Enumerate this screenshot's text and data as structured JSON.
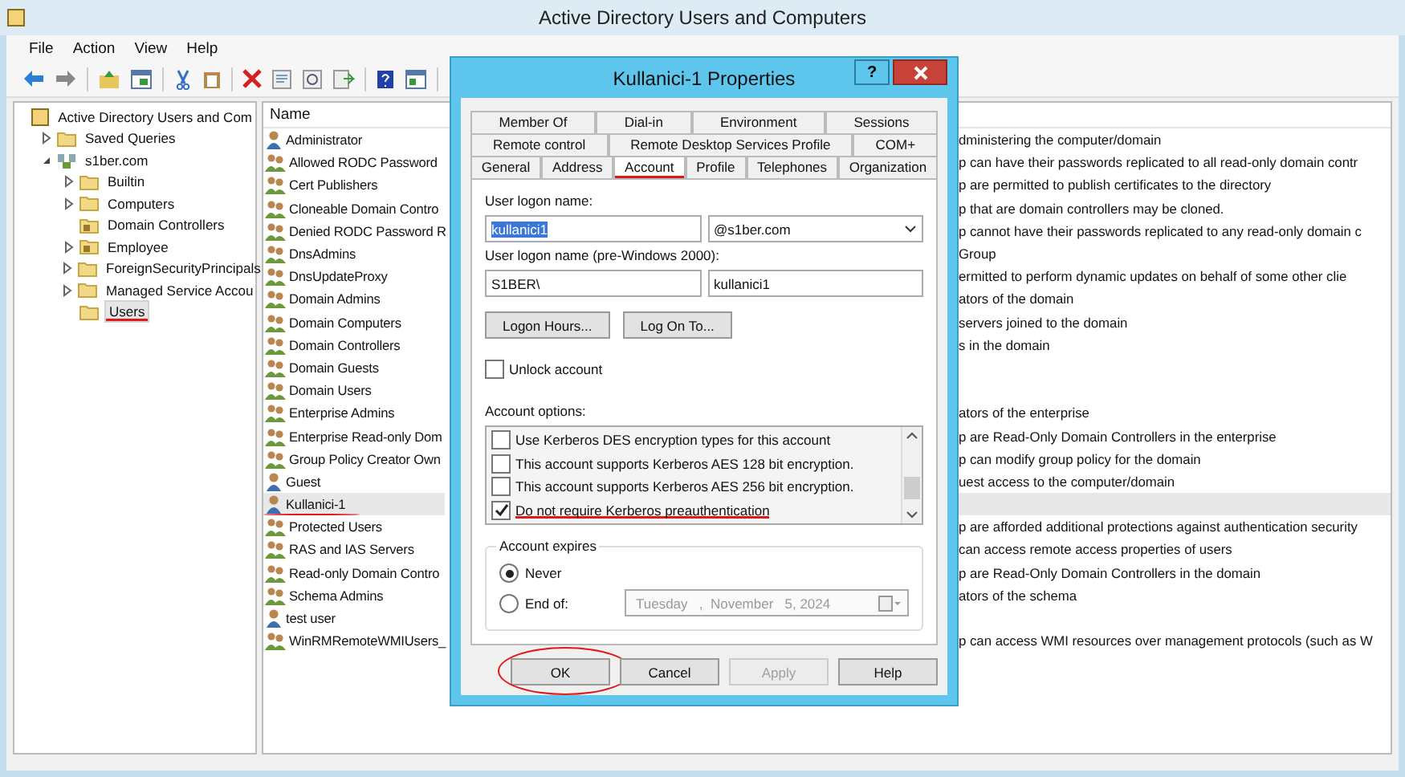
{
  "window": {
    "title": "Active Directory Users and Computers"
  },
  "menu": [
    "File",
    "Action",
    "View",
    "Help"
  ],
  "tree": [
    {
      "label": "Active Directory Users and Com",
      "kind": "root",
      "selected": false,
      "annotated": false,
      "children": [
        {
          "label": "Saved Queries",
          "kind": "folder",
          "expanded": false,
          "selected": false,
          "annotated": false
        },
        {
          "label": "s1ber.com",
          "kind": "domain",
          "expanded": true,
          "selected": false,
          "annotated": false,
          "children": [
            {
              "label": "Builtin",
              "kind": "folder",
              "expanded": false,
              "selected": false,
              "annotated": false
            },
            {
              "label": "Computers",
              "kind": "folder",
              "expanded": false,
              "selected": false,
              "annotated": false
            },
            {
              "label": "Domain Controllers",
              "kind": "ou",
              "selected": false,
              "annotated": false
            },
            {
              "label": "Employee",
              "kind": "ou",
              "expanded": false,
              "selected": false,
              "annotated": false
            },
            {
              "label": "ForeignSecurityPrincipals",
              "kind": "folder",
              "expanded": false,
              "selected": false,
              "annotated": false
            },
            {
              "label": "Managed Service Accou",
              "kind": "folder",
              "expanded": false,
              "selected": false,
              "annotated": false
            },
            {
              "label": "Users",
              "kind": "folder",
              "selected": true,
              "annotated": true
            }
          ]
        }
      ]
    }
  ],
  "list": {
    "columns": [
      "Name"
    ],
    "rows": [
      {
        "name": "Administrator",
        "kind": "user",
        "description": "dministering the computer/domain",
        "selected": false,
        "annotated": false
      },
      {
        "name": "Allowed RODC Password",
        "kind": "group",
        "description": "p can have their passwords replicated to all read-only domain contr",
        "selected": false,
        "annotated": false
      },
      {
        "name": "Cert Publishers",
        "kind": "group",
        "description": "p are permitted to publish certificates to the directory",
        "selected": false,
        "annotated": false
      },
      {
        "name": "Cloneable Domain Contro",
        "kind": "group",
        "description": "p that are domain controllers may be cloned.",
        "selected": false,
        "annotated": false
      },
      {
        "name": "Denied RODC Password R",
        "kind": "group",
        "description": "p cannot have their passwords replicated to any read-only domain c",
        "selected": false,
        "annotated": false
      },
      {
        "name": "DnsAdmins",
        "kind": "group",
        "description": "Group",
        "selected": false,
        "annotated": false
      },
      {
        "name": "DnsUpdateProxy",
        "kind": "group",
        "description": "ermitted to perform dynamic updates on behalf of some other clie",
        "selected": false,
        "annotated": false
      },
      {
        "name": "Domain Admins",
        "kind": "group",
        "description": "ators of the domain",
        "selected": false,
        "annotated": false
      },
      {
        "name": "Domain Computers",
        "kind": "group",
        "description": "servers joined to the domain",
        "selected": false,
        "annotated": false
      },
      {
        "name": "Domain Controllers",
        "kind": "group",
        "description": "s in the domain",
        "selected": false,
        "annotated": false
      },
      {
        "name": "Domain Guests",
        "kind": "group",
        "selected": false,
        "annotated": false
      },
      {
        "name": "Domain Users",
        "kind": "group",
        "selected": false,
        "annotated": false
      },
      {
        "name": "Enterprise Admins",
        "kind": "group",
        "description": "ators of the enterprise",
        "selected": false,
        "annotated": false
      },
      {
        "name": "Enterprise Read-only Dom",
        "kind": "group",
        "description": "p are Read-Only Domain Controllers in the enterprise",
        "selected": false,
        "annotated": false
      },
      {
        "name": "Group Policy Creator Own",
        "kind": "group",
        "description": "p can modify group policy for the domain",
        "selected": false,
        "annotated": false
      },
      {
        "name": "Guest",
        "kind": "user",
        "description": "uest access to the computer/domain",
        "selected": false,
        "annotated": false
      },
      {
        "name": "Kullanici-1",
        "kind": "user",
        "selected": true,
        "annotated": true
      },
      {
        "name": "Protected Users",
        "kind": "group",
        "description": "p are afforded additional protections against authentication security",
        "selected": false,
        "annotated": false
      },
      {
        "name": "RAS and IAS Servers",
        "kind": "group",
        "description": "can access remote access properties of users",
        "selected": false,
        "annotated": false
      },
      {
        "name": "Read-only Domain Contro",
        "kind": "group",
        "description": "p are Read-Only Domain Controllers in the domain",
        "selected": false,
        "annotated": false
      },
      {
        "name": "Schema Admins",
        "kind": "group",
        "description": "ators of the schema",
        "selected": false,
        "annotated": false
      },
      {
        "name": "test user",
        "kind": "user",
        "selected": false,
        "annotated": false
      },
      {
        "name": "WinRMRemoteWMIUsers_",
        "kind": "group",
        "description": "p can access WMI resources over management protocols (such as W",
        "selected": false,
        "annotated": false
      }
    ]
  },
  "dialog": {
    "title": "Kullanici-1 Properties",
    "help_button": "?",
    "tab_rows": [
      [
        {
          "label": "Member Of",
          "selected": false,
          "annotated": false
        },
        {
          "label": "Dial-in",
          "selected": false,
          "annotated": false
        },
        {
          "label": "Environment",
          "selected": false,
          "annotated": false
        },
        {
          "label": "Sessions",
          "selected": false,
          "annotated": false
        }
      ],
      [
        {
          "label": "Remote control",
          "selected": false,
          "annotated": false
        },
        {
          "label": "Remote Desktop Services Profile",
          "selected": false,
          "annotated": false
        },
        {
          "label": "COM+",
          "selected": false,
          "annotated": false
        }
      ],
      [
        {
          "label": "General",
          "selected": false,
          "annotated": false
        },
        {
          "label": "Address",
          "selected": false,
          "annotated": false
        },
        {
          "label": "Account",
          "selected": true,
          "annotated": true
        },
        {
          "label": "Profile",
          "selected": false,
          "annotated": false
        },
        {
          "label": "Telephones",
          "selected": false,
          "annotated": false
        },
        {
          "label": "Organization",
          "selected": false,
          "annotated": false
        }
      ]
    ],
    "logon_label": "User logon name:",
    "logon_value": "kullanici1",
    "domain_value": "@s1ber.com",
    "pre2000_label": "User logon name (pre-Windows 2000):",
    "pre2000_domain": "S1BER\\",
    "pre2000_value": "kullanici1",
    "action_buttons": [
      "Logon Hours...",
      "Log On To..."
    ],
    "unlock": {
      "label": "Unlock account",
      "checked": false
    },
    "options_label": "Account options:",
    "options": [
      {
        "label": "Use Kerberos DES encryption types for this account",
        "checked": false,
        "annotated": false
      },
      {
        "label": "This account supports Kerberos AES 128 bit encryption.",
        "checked": false,
        "annotated": false
      },
      {
        "label": "This account supports Kerberos AES 256 bit encryption.",
        "checked": false,
        "annotated": false
      },
      {
        "label": "Do not require Kerberos preauthentication",
        "checked": true,
        "annotated": true
      }
    ],
    "expires_label": "Account expires",
    "expires": [
      {
        "label": "Never",
        "selected": true
      },
      {
        "label": "End of:",
        "selected": false
      }
    ],
    "date": {
      "value": "Tuesday   ,  November   5, 2024",
      "disabled": true
    },
    "buttons": [
      {
        "label": "OK",
        "disabled": false,
        "annotated": true
      },
      {
        "label": "Cancel",
        "disabled": false,
        "annotated": false
      },
      {
        "label": "Apply",
        "disabled": true,
        "annotated": false
      },
      {
        "label": "Help",
        "disabled": false,
        "annotated": false
      }
    ]
  }
}
